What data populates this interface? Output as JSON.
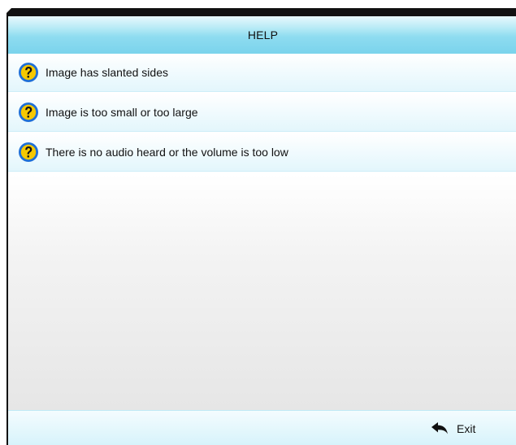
{
  "header": {
    "title": "HELP"
  },
  "help_items": [
    {
      "label": "Image has slanted sides",
      "icon": "question-mark-icon"
    },
    {
      "label": "Image is too small or too large",
      "icon": "question-mark-icon"
    },
    {
      "label": "There is no audio heard or the volume is too low",
      "icon": "question-mark-icon"
    }
  ],
  "footer": {
    "exit_label": "Exit",
    "exit_icon": "return-arrow-icon"
  },
  "colors": {
    "header_accent": "#7ad3ec",
    "item_tint": "#e3f6fc",
    "icon_blue": "#1f6fd6",
    "icon_yellow": "#f6c800"
  }
}
